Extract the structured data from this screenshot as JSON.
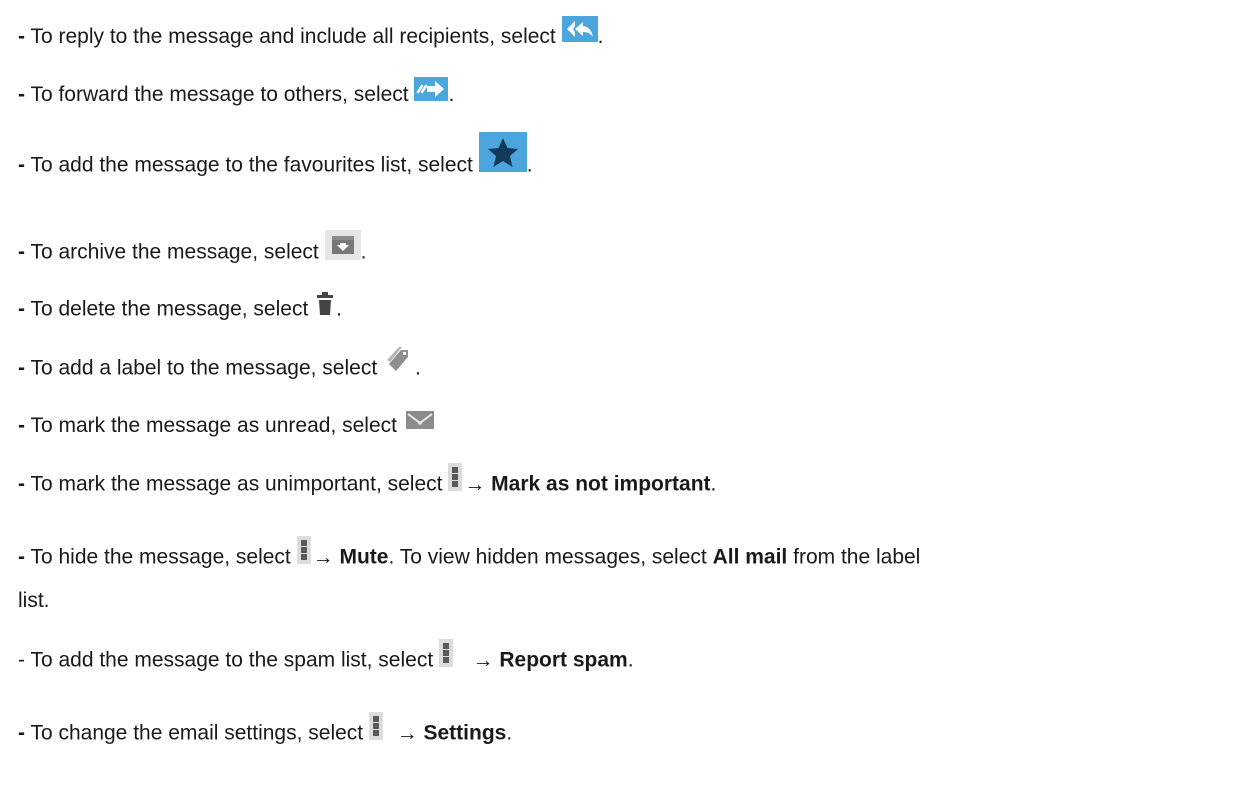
{
  "lines": [
    {
      "dash": "-",
      "text": " To reply to the message and include all recipients, select ",
      "icon": "reply-all-icon",
      "after": "."
    },
    {
      "dash": "-",
      "text": " To forward the message to others, select ",
      "icon": "forward-icon",
      "after": "."
    },
    {
      "dash": "-",
      "text": " To add the message to the favourites list, select ",
      "icon": "star-icon",
      "after": "."
    },
    {
      "dash": "-",
      "text": " To archive the message, select ",
      "icon": "archive-icon",
      "after": "."
    },
    {
      "dash": "-",
      "text": " To delete the message, select ",
      "icon": "trash-icon",
      "after": "."
    },
    {
      "dash": "-",
      "text": " To add a label to the message, select ",
      "icon": "label-tag-icon",
      "after": "."
    },
    {
      "dash": "-",
      "text": " To mark the message as unread, select ",
      "icon": "unread-envelope-icon",
      "after": ""
    },
    {
      "dash": "-",
      "text": " To mark the message as unimportant, select ",
      "icon": "more-options-icon",
      "arrow": "→",
      "bold": "Mark as not important",
      "after": "."
    },
    {
      "dash": "-",
      "text": " To hide the message, select ",
      "icon": "more-options-icon",
      "arrow": "→",
      "bold": "Mute",
      "mid": ". To view hidden messages, select ",
      "bold2": "All mail",
      "tail": " from the label",
      "cont": "list."
    },
    {
      "dash": "-",
      "text": " To add the message to the spam list, select ",
      "icon": "more-options-icon",
      "arrow": "→",
      "bold": "Report spam",
      "after": "."
    },
    {
      "dash": "-",
      "text": " To change the email settings, select ",
      "icon": "more-options-icon",
      "arrow": "→",
      "bold": "Settings",
      "after": "."
    }
  ],
  "colors": {
    "icon_blue": "#4aa6dc",
    "icon_gray": "#dcdcdc",
    "text": "#1a1a1a"
  }
}
